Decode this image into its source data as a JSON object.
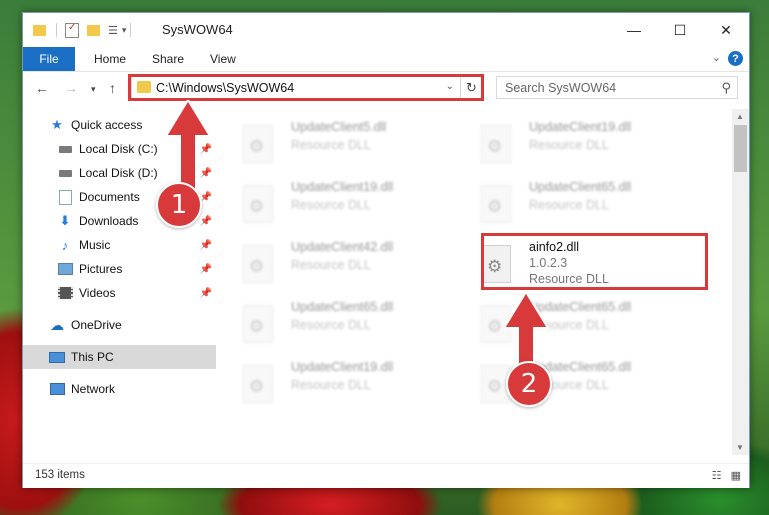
{
  "window": {
    "title": "SysWOW64",
    "controls": {
      "minimize": "—",
      "maximize": "☐",
      "close": "✕"
    }
  },
  "ribbon": {
    "tabs": [
      "File",
      "Home",
      "Share",
      "View"
    ],
    "help": "?"
  },
  "nav": {
    "address": "C:\\Windows\\SysWOW64",
    "search_placeholder": "Search SysWOW64"
  },
  "sidebar": {
    "items": [
      {
        "label": "Quick access",
        "icon": "star-icon",
        "pinned": false
      },
      {
        "label": "Local Disk (C:)",
        "icon": "drive-icon",
        "pinned": true
      },
      {
        "label": "Local Disk (D:)",
        "icon": "drive-icon",
        "pinned": true
      },
      {
        "label": "Documents",
        "icon": "documents-icon",
        "pinned": true
      },
      {
        "label": "Downloads",
        "icon": "download-icon",
        "pinned": true
      },
      {
        "label": "Music",
        "icon": "music-icon",
        "pinned": true
      },
      {
        "label": "Pictures",
        "icon": "pictures-icon",
        "pinned": true
      },
      {
        "label": "Videos",
        "icon": "videos-icon",
        "pinned": true
      },
      {
        "label": "OneDrive",
        "icon": "cloud-icon",
        "pinned": false
      },
      {
        "label": "This PC",
        "icon": "computer-icon",
        "pinned": false,
        "selected": true
      },
      {
        "label": "Network",
        "icon": "network-icon",
        "pinned": false
      }
    ]
  },
  "files": [
    {
      "name": "UpdateClient5.dll",
      "sub1": "Resource DLL",
      "faded": true
    },
    {
      "name": "UpdateClient19.dll",
      "sub1": "Resource DLL",
      "faded": true
    },
    {
      "name": "UpdateClient19.dll",
      "sub1": "Resource DLL",
      "faded": true
    },
    {
      "name": "UpdateClient65.dll",
      "sub1": "Resource DLL",
      "faded": true
    },
    {
      "name": "UpdateClient42.dll",
      "sub1": "Resource DLL",
      "faded": true
    },
    {
      "name": "ainfo2.dll",
      "sub1": "1.0.2.3",
      "sub2": "Resource DLL",
      "faded": false
    },
    {
      "name": "UpdateClient65.dll",
      "sub1": "Resource DLL",
      "faded": true
    },
    {
      "name": "UpdateClient65.dll",
      "sub1": "Resource DLL",
      "faded": true
    },
    {
      "name": "UpdateClient19.dll",
      "sub1": "Resource DLL",
      "faded": true
    },
    {
      "name": "UpdateClient65.dll",
      "sub1": "Resource DLL",
      "faded": true
    }
  ],
  "status": {
    "item_count": "153 items"
  },
  "annotations": {
    "step1": "1",
    "step2": "2",
    "color": "#d8393b"
  }
}
